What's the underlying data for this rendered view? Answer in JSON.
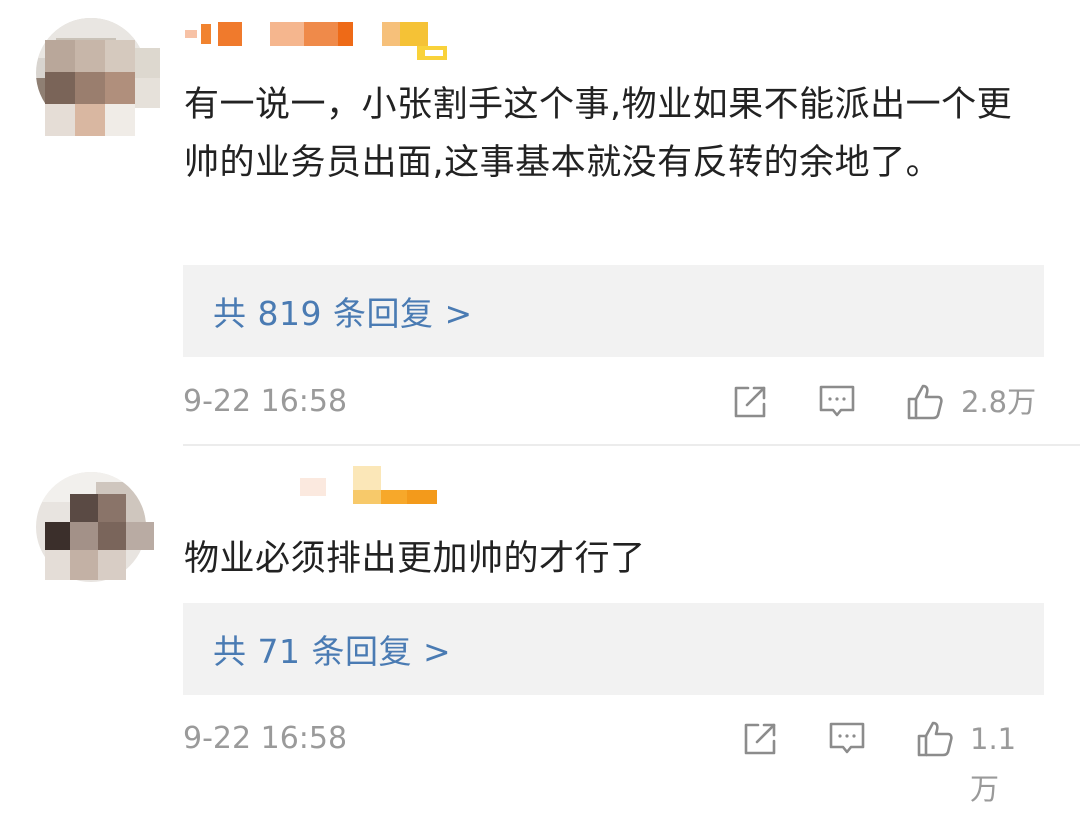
{
  "comments": [
    {
      "text": "有一说一，小张割手这个事,物业如果不能派出一个更帅的业务员出面,这事基本就没有反转的余地了。",
      "replies_label": "共 819 条回复 >",
      "time": "9-22 16:58",
      "likes": "2.8万"
    },
    {
      "text": "物业必须排出更加帅的才行了",
      "replies_label": "共 71 条回复 >",
      "time": "9-22 16:58",
      "likes": "1.1万"
    }
  ],
  "icons": {
    "share": "share-icon",
    "comment": "comment-icon",
    "like": "thumbs-up-icon"
  },
  "colors": {
    "link": "#4a7bb3",
    "meta": "#9a9a9a",
    "reply_bg": "#f2f2f2"
  }
}
